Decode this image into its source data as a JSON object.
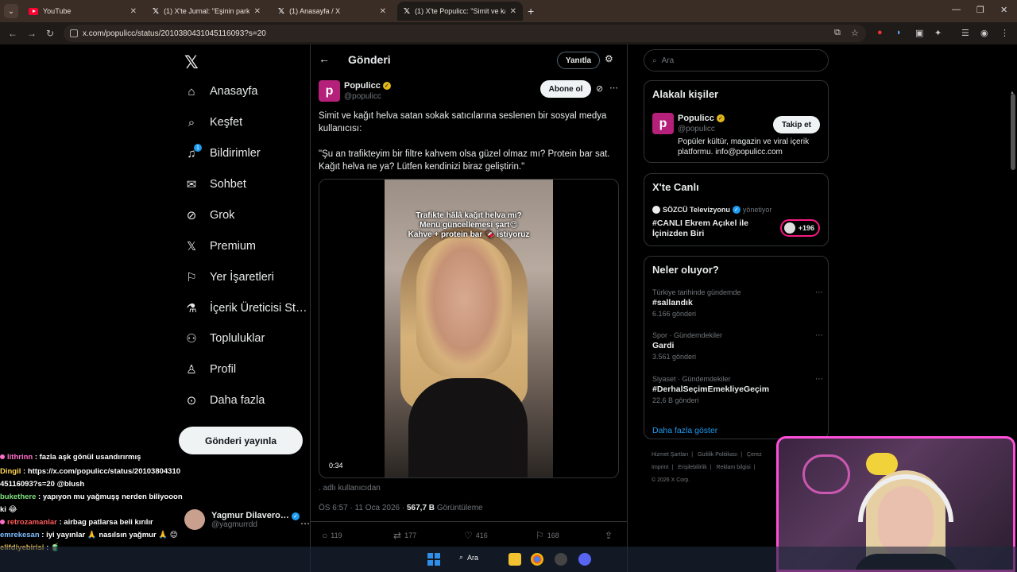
{
  "browser": {
    "tabs": [
      {
        "title": "YouTube",
        "icon": "youtube-icon"
      },
      {
        "title": "(1) X'te Jurnal: \"Eşinin park etm…",
        "icon": "x-icon"
      },
      {
        "title": "(1) Anasayfa / X",
        "icon": "x-icon"
      },
      {
        "title": "(1) X'te Populicc: \"Simit ve kağıt…",
        "icon": "x-icon",
        "active": true
      }
    ],
    "url": "x.com/populicc/status/2010380431045116093?s=20"
  },
  "nav": {
    "items": [
      {
        "label": "Anasayfa",
        "icon": "home-icon",
        "glyph": "⌂"
      },
      {
        "label": "Keşfet",
        "icon": "search-icon",
        "glyph": "⌕"
      },
      {
        "label": "Bildirimler",
        "icon": "bell-icon",
        "glyph": "🔔",
        "badge": "1"
      },
      {
        "label": "Sohbet",
        "icon": "mail-icon",
        "glyph": "✉"
      },
      {
        "label": "Grok",
        "icon": "grok-icon",
        "glyph": "⊘"
      },
      {
        "label": "Premium",
        "icon": "x-premium-icon",
        "glyph": "𝕏"
      },
      {
        "label": "Yer İşaretleri",
        "icon": "bookmark-icon",
        "glyph": "⚐"
      },
      {
        "label": "İçerik Üreticisi St…",
        "icon": "flask-icon",
        "glyph": "⚗"
      },
      {
        "label": "Topluluklar",
        "icon": "communities-icon",
        "glyph": "⚇"
      },
      {
        "label": "Profil",
        "icon": "profile-icon",
        "glyph": "♙"
      },
      {
        "label": "Daha fazla",
        "icon": "more-circle-icon",
        "glyph": "⋯"
      }
    ],
    "post_button": "Gönderi yayınla"
  },
  "account": {
    "name": "Yagmur Dilavero…",
    "handle": "@yagmurrdd"
  },
  "post": {
    "header_title": "Gönderi",
    "reply_label": "Yanıtla",
    "author_name": "Populicc",
    "author_handle": "@populicc",
    "subscribe_label": "Abone ol",
    "text": "Simit ve kağıt helva satan sokak satıcılarına seslenen bir sosyal medya kullanıcısı:\n\n\"Şu an trafikteyim bir filtre kahvem olsa güzel olmaz mı? Protein bar sat. Kağıt helva ne ya? Lütfen kendinizi biraz geliştirin.\"",
    "video_caption": "Trafikte hâlâ kağıt helva mı?\nMenü güncellemesi şart😉\nKahve + protein bar 🍫 istiyoruz",
    "video_duration": "0:34",
    "from_user": ". adlı kullanıcıdan",
    "time": "ÖS 6:57 · 11 Oca 2026 ·",
    "views": "567,7 B",
    "views_label": "Görüntüleme",
    "replies": "119",
    "reposts": "177",
    "likes": "416",
    "bookmarks": "168"
  },
  "sidebar": {
    "search_placeholder": "Ara",
    "related_title": "Alakalı kişiler",
    "related_name": "Populicc",
    "related_handle": "@populicc",
    "follow_label": "Takip et",
    "related_bio": "Popüler kültür, magazin ve viral içerik platformu. info@populicc.com",
    "live_title_header": "X'te Canlı",
    "live_host": "SÖZCÜ Televizyonu",
    "live_role": "yönetiyor",
    "live_title": "#CANLI Ekrem Açıkel ile İçinizden Biri",
    "live_count": "+196",
    "trends_title": "Neler oluyor?",
    "trends": [
      {
        "context": "Türkiye tarihinde gündemde",
        "name": "#sallandık",
        "posts": "6.166 gönderi"
      },
      {
        "context": "Spor · Gündemdekiler",
        "name": "Gardi",
        "posts": "3.561 gönderi"
      },
      {
        "context": "Siyaset · Gündemdekiler",
        "name": "#DerhalSeçimEmekliyeGeçim",
        "posts": "22,6 B gönderi"
      }
    ],
    "show_more": "Daha fazla göster",
    "footer": [
      "Hizmet Şartları",
      "|",
      "Gizlilik Politikası",
      "|",
      "Çerez",
      "Imprint",
      "|",
      "Erişilebilirlik",
      "|",
      "Reklam bilgisi",
      "|",
      "© 2026 X Corp."
    ]
  },
  "chat": [
    {
      "user": "lithrinn",
      "text": ": fazla aşk gönül usandırırmış",
      "color": "u1"
    },
    {
      "user": "Dingil",
      "text": ": https://x.com/populicc/status/2010380431045116093?s=20 @blush",
      "color": "u6"
    },
    {
      "user": "bukethere",
      "text": ": yapıyon mu yağmuşş nerden biliyooon ki 😂",
      "color": "u2"
    },
    {
      "user": "retrozamanlar",
      "text": ": airbag patlarsa beli kırılır",
      "color": "u4"
    },
    {
      "user": "emrekesan",
      "text": ": iyi yayınlar 🙏 nasılsın yağmur 🙏 😊",
      "color": "u5"
    },
    {
      "user": "elifdiyebirisi",
      "text": ": 🧃",
      "color": "u6"
    }
  ],
  "taskbar": {
    "search_label": "Ara"
  }
}
